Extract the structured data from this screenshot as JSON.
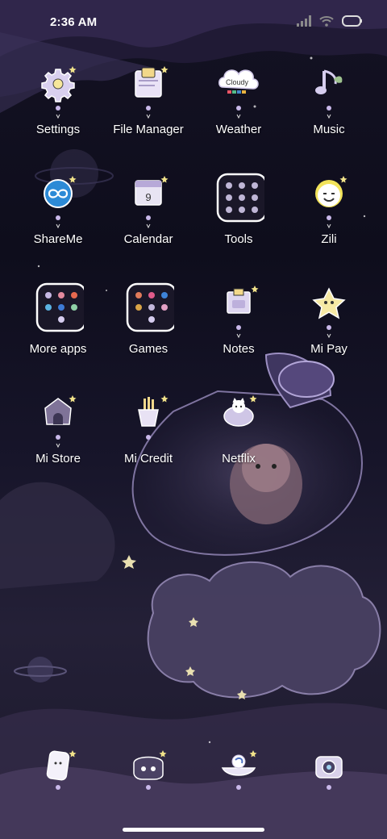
{
  "status_bar": {
    "time": "2:36 AM",
    "icons": [
      "signal-icon",
      "wifi-icon",
      "battery-icon"
    ]
  },
  "apps": [
    {
      "label": "Settings",
      "icon": "gear-icon"
    },
    {
      "label": "File Manager",
      "icon": "folder-icon"
    },
    {
      "label": "Weather",
      "icon": "cloud-icon",
      "badge_text": "Cloudy"
    },
    {
      "label": "Music",
      "icon": "music-note-icon"
    },
    {
      "label": "ShareMe",
      "icon": "infinity-icon"
    },
    {
      "label": "Calendar",
      "icon": "calendar-icon",
      "date_text": "9"
    },
    {
      "label": "Tools",
      "icon": "folder-grid-icon"
    },
    {
      "label": "Zili",
      "icon": "smiley-icon"
    },
    {
      "label": "More apps",
      "icon": "folder-grid-icon"
    },
    {
      "label": "Games",
      "icon": "folder-grid-icon"
    },
    {
      "label": "Notes",
      "icon": "note-icon"
    },
    {
      "label": "Mi Pay",
      "icon": "star-icon"
    },
    {
      "label": "Mi Store",
      "icon": "house-icon"
    },
    {
      "label": "Mi Credit",
      "icon": "fries-icon"
    },
    {
      "label": "Netflix",
      "icon": "cat-icon"
    }
  ],
  "dock": [
    {
      "icon": "phone-icon"
    },
    {
      "icon": "message-icon"
    },
    {
      "icon": "browser-icon"
    },
    {
      "icon": "camera-icon"
    }
  ],
  "colors": {
    "accent": "#b9a6e0",
    "text": "#ffffff"
  }
}
